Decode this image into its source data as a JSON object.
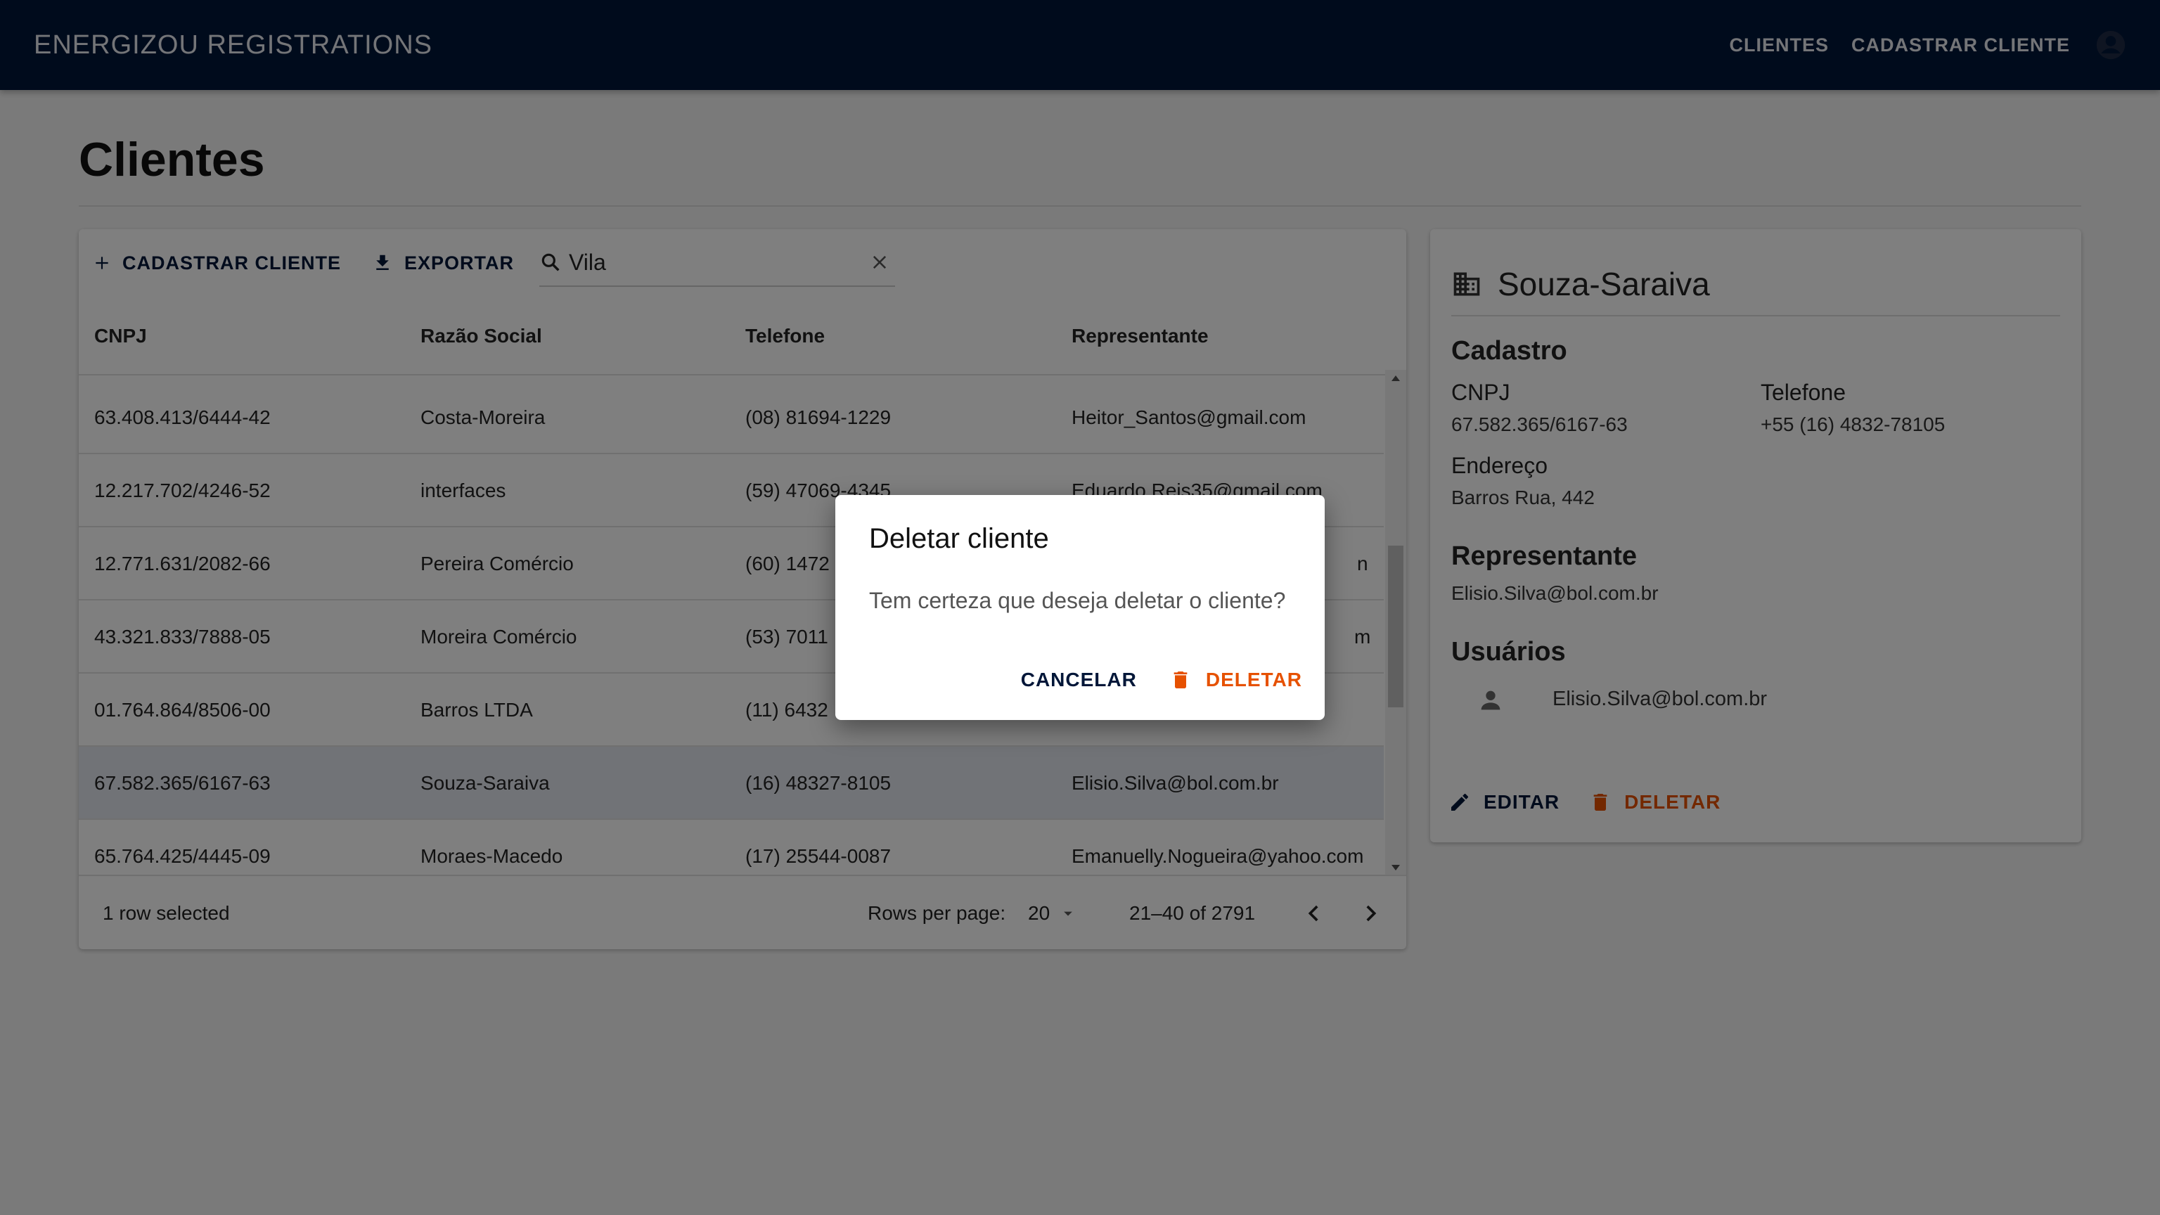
{
  "colors": {
    "primary": "#011638",
    "danger": "#e65100",
    "selected_row": "#e3e6ee"
  },
  "appbar": {
    "title": "ENERGIZOU REGISTRATIONS",
    "nav": [
      "CLIENTES",
      "CADASTRAR CLIENTE"
    ],
    "avatar_icon": "account-circle-icon"
  },
  "page": {
    "title": "Clientes"
  },
  "table": {
    "toolbar": {
      "add_label": "CADASTRAR CLIENTE",
      "export_label": "EXPORTAR",
      "search_value": "Vila"
    },
    "columns": [
      "CNPJ",
      "Razão Social",
      "Telefone",
      "Representante"
    ],
    "rows": [
      {
        "cnpj": "63.408.413/6444-42",
        "razao": "Costa-Moreira",
        "telefone": "(08) 81694-1229",
        "rep": "Heitor_Santos@gmail.com"
      },
      {
        "cnpj": "12.217.702/4246-52",
        "razao": "interfaces",
        "telefone": "(59) 47069-4345",
        "rep": "Eduardo.Reis35@gmail.com"
      },
      {
        "cnpj": "12.771.631/2082-66",
        "razao": "Pereira Comércio",
        "telefone": "(60) 1472",
        "rep": "n"
      },
      {
        "cnpj": "43.321.833/7888-05",
        "razao": "Moreira Comércio",
        "telefone": "(53) 7011",
        "rep": "m"
      },
      {
        "cnpj": "01.764.864/8506-00",
        "razao": "Barros LTDA",
        "telefone": "(11) 6432",
        "rep": ""
      },
      {
        "cnpj": "67.582.365/6167-63",
        "razao": "Souza-Saraiva",
        "telefone": "(16) 48327-8105",
        "rep": "Elisio.Silva@bol.com.br"
      },
      {
        "cnpj": "65.764.425/4445-09",
        "razao": "Moraes-Macedo",
        "telefone": "(17) 25544-0087",
        "rep": "Emanuelly.Nogueira@yahoo.com"
      }
    ],
    "footer": {
      "selected": "1 row selected",
      "rows_per_page_label": "Rows per page:",
      "rows_per_page": "20",
      "range": "21–40 of 2791"
    }
  },
  "detail": {
    "name": "Souza-Saraiva",
    "cadastro_title": "Cadastro",
    "cnpj_label": "CNPJ",
    "cnpj": "67.582.365/6167-63",
    "telefone_label": "Telefone",
    "telefone": "+55 (16) 4832-78105",
    "endereco_label": "Endereço",
    "endereco": "Barros Rua, 442",
    "representante_title": "Representante",
    "representante": "Elisio.Silva@bol.com.br",
    "usuarios_title": "Usuários",
    "usuario": "Elisio.Silva@bol.com.br",
    "edit_label": "EDITAR",
    "delete_label": "DELETAR"
  },
  "dialog": {
    "title": "Deletar cliente",
    "text": "Tem certeza que deseja deletar o cliente?",
    "cancel_label": "CANCELAR",
    "delete_label": "DELETAR"
  }
}
